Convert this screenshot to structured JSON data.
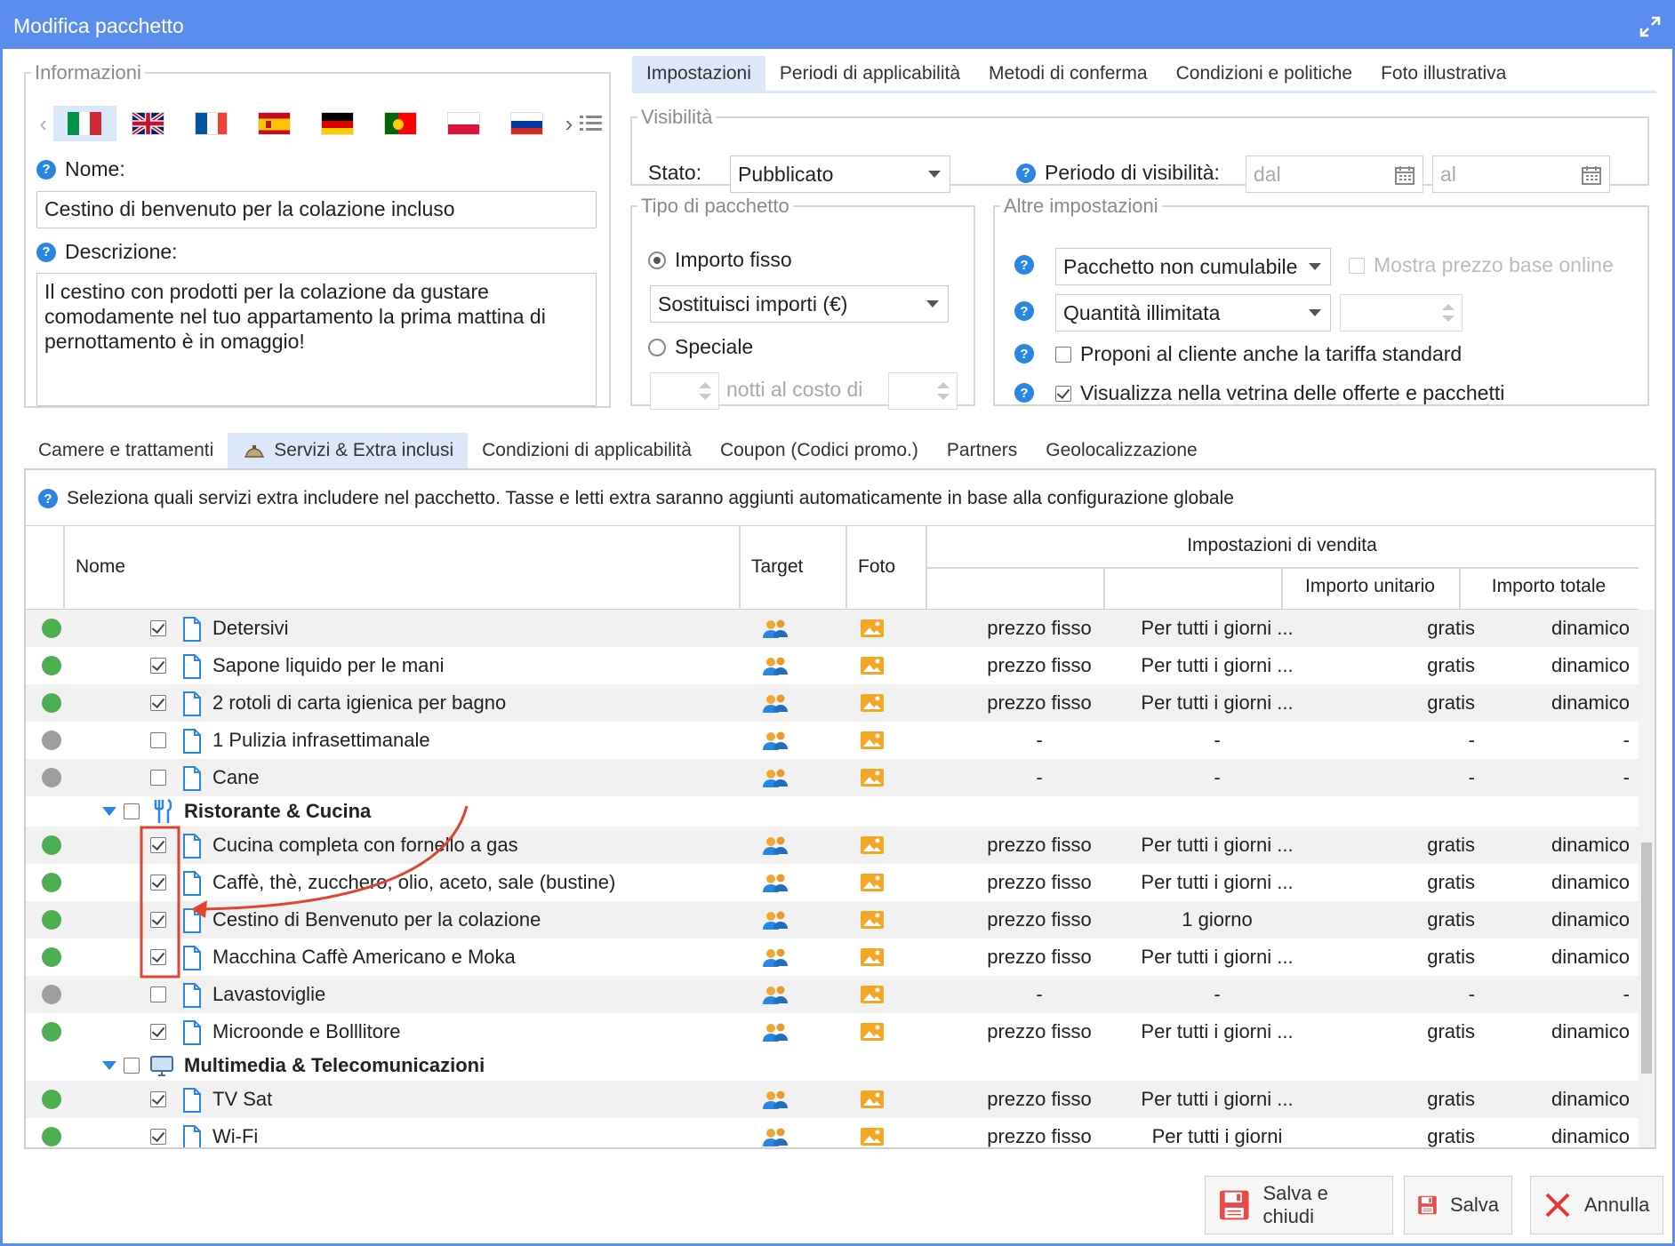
{
  "window": {
    "title": "Modifica pacchetto"
  },
  "info": {
    "legend": "Informazioni",
    "flags": [
      "it",
      "gb",
      "fr",
      "es",
      "de",
      "pt",
      "pl",
      "ru"
    ],
    "name_label": "Nome:",
    "name_value": "Cestino di benvenuto per la colazione incluso",
    "desc_label": "Descrizione:",
    "desc_value": "Il  cestino con prodotti per la colazione da gustare comodamente nel tuo appartamento la prima mattina di pernottamento è in omaggio!"
  },
  "top_tabs": [
    "Impostazioni",
    "Periodi di applicabilità",
    "Metodi di conferma",
    "Condizioni e politiche",
    "Foto illustrativa"
  ],
  "visibility": {
    "legend": "Visibilità",
    "stato_label": "Stato:",
    "stato_value": "Pubblicato",
    "period_label": "Periodo di visibilità:",
    "from_placeholder": "dal",
    "to_placeholder": "al"
  },
  "package_type": {
    "legend": "Tipo di pacchetto",
    "fixed_label": "Importo fisso",
    "fixed_select": "Sostituisci importi (€)",
    "special_label": "Speciale",
    "nights_label": "notti al costo di"
  },
  "other_settings": {
    "legend": "Altre impostazioni",
    "cumulable_select": "Pacchetto non cumulabile",
    "show_base_price": "Mostra prezzo base online",
    "quantity_select": "Quantità illimitata",
    "propose_standard": "Proponi al cliente anche la tariffa standard",
    "show_showcase": "Visualizza nella vetrina delle offerte e pacchetti"
  },
  "bottom_tabs": [
    "Camere e trattamenti",
    "Servizi & Extra inclusi",
    "Condizioni di applicabilità",
    "Coupon (Codici promo.)",
    "Partners",
    "Geolocalizzazione"
  ],
  "hint": "Seleziona quali servizi extra includere nel pacchetto. Tasse e letti extra saranno aggiunti automaticamente in base alla configurazione globale",
  "grid": {
    "col_name": "Nome",
    "col_target": "Target",
    "col_foto": "Foto",
    "col_sales": "Impostazioni di vendita",
    "col_unit": "Importo unitario",
    "col_total": "Importo totale",
    "rows": [
      {
        "type": "item",
        "active": true,
        "checked": true,
        "name": "Detersivi",
        "c1": "prezzo fisso",
        "c2": "Per tutti i giorni ...",
        "c3": "gratis",
        "c4": "dinamico"
      },
      {
        "type": "item",
        "active": true,
        "checked": true,
        "name": "Sapone liquido per le mani",
        "c1": "prezzo fisso",
        "c2": "Per tutti i giorni ...",
        "c3": "gratis",
        "c4": "dinamico"
      },
      {
        "type": "item",
        "active": true,
        "checked": true,
        "name": "2 rotoli di carta igienica per bagno",
        "c1": "prezzo fisso",
        "c2": "Per tutti i giorni ...",
        "c3": "gratis",
        "c4": "dinamico"
      },
      {
        "type": "item",
        "active": false,
        "checked": false,
        "name": "1 Pulizia infrasettimanale",
        "c1": "-",
        "c2": "-",
        "c3": "-",
        "c4": "-"
      },
      {
        "type": "item",
        "active": false,
        "checked": false,
        "name": "Cane",
        "c1": "-",
        "c2": "-",
        "c3": "-",
        "c4": "-"
      },
      {
        "type": "group",
        "icon": "fork-knife-icon",
        "name": "Ristorante & Cucina"
      },
      {
        "type": "item",
        "active": true,
        "checked": true,
        "name": "Cucina completa con fornello a gas",
        "c1": "prezzo fisso",
        "c2": "Per tutti i giorni ...",
        "c3": "gratis",
        "c4": "dinamico"
      },
      {
        "type": "item",
        "active": true,
        "checked": true,
        "name": "Caffè, thè, zucchero, olio, aceto, sale (bustine)",
        "c1": "prezzo fisso",
        "c2": "Per tutti i giorni ...",
        "c3": "gratis",
        "c4": "dinamico"
      },
      {
        "type": "item",
        "active": true,
        "checked": true,
        "name": "Cestino di Benvenuto per la colazione",
        "c1": "prezzo fisso",
        "c2": "1 giorno",
        "c3": "gratis",
        "c4": "dinamico"
      },
      {
        "type": "item",
        "active": true,
        "checked": true,
        "name": "Macchina Caffè Americano e Moka",
        "c1": "prezzo fisso",
        "c2": "Per tutti i giorni ...",
        "c3": "gratis",
        "c4": "dinamico"
      },
      {
        "type": "item",
        "active": false,
        "checked": false,
        "name": "Lavastoviglie",
        "c1": "-",
        "c2": "-",
        "c3": "-",
        "c4": "-"
      },
      {
        "type": "item",
        "active": true,
        "checked": true,
        "name": "Microonde e Bolllitore",
        "c1": "prezzo fisso",
        "c2": "Per tutti i giorni ...",
        "c3": "gratis",
        "c4": "dinamico"
      },
      {
        "type": "group",
        "icon": "monitor-icon",
        "name": "Multimedia & Telecomunicazioni"
      },
      {
        "type": "item",
        "active": true,
        "checked": true,
        "name": "TV Sat",
        "c1": "prezzo fisso",
        "c2": "Per tutti i giorni ...",
        "c3": "gratis",
        "c4": "dinamico"
      },
      {
        "type": "item",
        "active": true,
        "checked": true,
        "name": "Wi-Fi",
        "c1": "prezzo fisso",
        "c2": "Per tutti i giorni",
        "c3": "gratis",
        "c4": "dinamico"
      }
    ]
  },
  "buttons": {
    "save_close": "Salva e chiudi",
    "save": "Salva",
    "cancel": "Annulla"
  },
  "colors": {
    "titlebar": "#5b8def",
    "active_tab": "#dce8fa",
    "status_on": "#4caf50",
    "status_off": "#9e9e9e",
    "annotation": "#e0442f"
  }
}
